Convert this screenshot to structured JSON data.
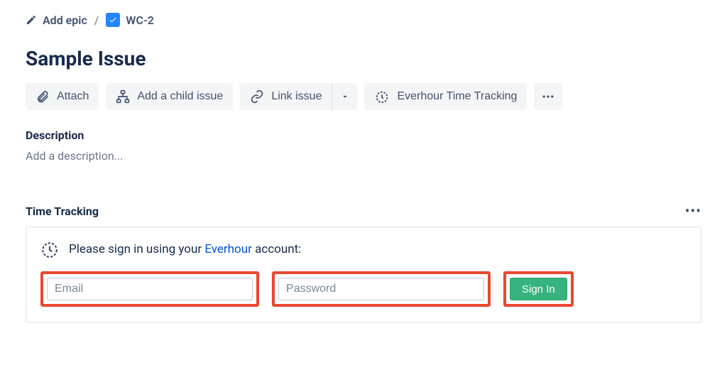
{
  "breadcrumb": {
    "add_epic": "Add epic",
    "separator": "/",
    "issue_key": "WC-2"
  },
  "issue": {
    "title": "Sample Issue"
  },
  "toolbar": {
    "attach": "Attach",
    "add_child": "Add a child issue",
    "link_issue": "Link issue",
    "everhour": "Everhour Time Tracking"
  },
  "description": {
    "label": "Description",
    "placeholder": "Add a description..."
  },
  "time_tracking": {
    "label": "Time Tracking",
    "msg_prefix": "Please sign in using your ",
    "msg_link": "Everhour",
    "msg_suffix": " account:",
    "email_placeholder": "Email",
    "password_placeholder": "Password",
    "signin": "Sign In"
  }
}
